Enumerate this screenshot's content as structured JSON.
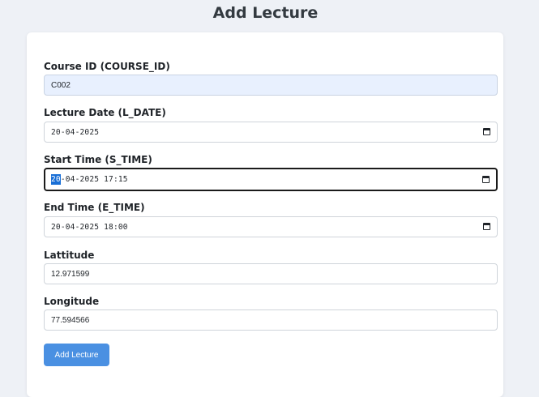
{
  "page": {
    "title": "Add Lecture"
  },
  "form": {
    "course_id": {
      "label": "Course ID (COURSE_ID)",
      "value": "C002"
    },
    "lecture_date": {
      "label": "Lecture Date (L_DATE)",
      "value": "20-04-2025"
    },
    "start_time": {
      "label": "Start Time (S_TIME)",
      "value_selected": "20",
      "value_rest": "-04-2025 17:15"
    },
    "end_time": {
      "label": "End Time (E_TIME)",
      "value": "20-04-2025 18:00"
    },
    "latitude": {
      "label": "Lattitude",
      "value": "12.971599"
    },
    "longitude": {
      "label": "Longitude",
      "value": "77.594566"
    },
    "submit_label": "Add Lecture"
  },
  "icons": {
    "date_picker": "calendar-icon"
  },
  "colors": {
    "button": "#4a90e2",
    "autofill": "#e8f0fe",
    "selection": "#1a6fd6"
  }
}
